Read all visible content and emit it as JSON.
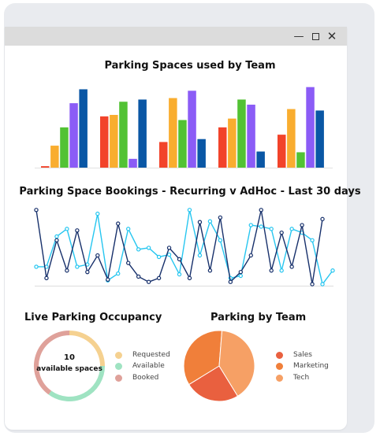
{
  "window": {
    "controls": [
      "minimize",
      "maximize",
      "close"
    ]
  },
  "bar_chart": {
    "title": "Parking Spaces used by Team",
    "colors": [
      "#f2432a",
      "#f9ad2f",
      "#52c234",
      "#8b5cf6",
      "#0a57a5"
    ]
  },
  "line_chart": {
    "title": "Parking Space Bookings - Recurring v AdHoc - Last 30 days",
    "colors": {
      "dark": "#17306b",
      "light": "#26c6f0"
    }
  },
  "occupancy": {
    "title": "Live Parking Occupancy",
    "center_value": "10",
    "center_label": "available spaces",
    "legend": [
      {
        "label": "Requested",
        "color": "#f5d190"
      },
      {
        "label": "Available",
        "color": "#9fe3c2"
      },
      {
        "label": "Booked",
        "color": "#dfa19a"
      }
    ]
  },
  "pie": {
    "title": "Parking by Team",
    "legend": [
      {
        "label": "Sales",
        "color": "#e9603f"
      },
      {
        "label": "Marketing",
        "color": "#f07f3a"
      },
      {
        "label": "Tech",
        "color": "#f6a065"
      }
    ]
  },
  "chart_data": [
    {
      "type": "bar",
      "title": "Parking Spaces used by Team",
      "categories": [
        "1",
        "2",
        "3",
        "4",
        "5"
      ],
      "series": [
        {
          "values": [
            2,
            70,
            35,
            55,
            45
          ]
        },
        {
          "values": [
            30,
            72,
            95,
            67,
            80
          ]
        },
        {
          "values": [
            55,
            90,
            65,
            93,
            21
          ]
        },
        {
          "values": [
            88,
            12,
            105,
            86,
            110
          ]
        },
        {
          "values": [
            107,
            93,
            39,
            22,
            78
          ]
        }
      ],
      "ylim": [
        0,
        115
      ]
    },
    {
      "type": "line",
      "title": "Parking Space Bookings - Recurring v AdHoc - Last 30 days",
      "x": [
        1,
        2,
        3,
        4,
        5,
        6,
        7,
        8,
        9,
        10,
        11,
        12,
        13,
        14,
        15,
        16,
        17,
        18,
        19,
        20,
        21,
        22,
        23,
        24,
        25,
        26,
        27,
        28,
        29,
        30
      ],
      "series": [
        {
          "color": "dark",
          "values": [
            100,
            10,
            60,
            20,
            73,
            18,
            40,
            8,
            82,
            30,
            12,
            5,
            10,
            50,
            35,
            10,
            84,
            20,
            90,
            5,
            18,
            40,
            100,
            20,
            70,
            25,
            80,
            2,
            88
          ]
        },
        {
          "color": "light",
          "values": [
            25,
            25,
            65,
            75,
            25,
            28,
            95,
            7,
            16,
            75,
            48,
            50,
            38,
            41,
            15,
            100,
            40,
            85,
            60,
            10,
            13,
            80,
            78,
            75,
            20,
            75,
            70,
            60,
            2,
            20
          ]
        }
      ],
      "ylim": [
        0,
        105
      ]
    },
    {
      "type": "pie",
      "title": "Live Parking Occupancy",
      "categories": [
        "Requested",
        "Available",
        "Booked"
      ],
      "values": [
        25,
        35,
        40
      ]
    },
    {
      "type": "pie",
      "title": "Parking by Team",
      "categories": [
        "Sales",
        "Marketing",
        "Tech"
      ],
      "values": [
        25,
        35,
        40
      ]
    }
  ]
}
